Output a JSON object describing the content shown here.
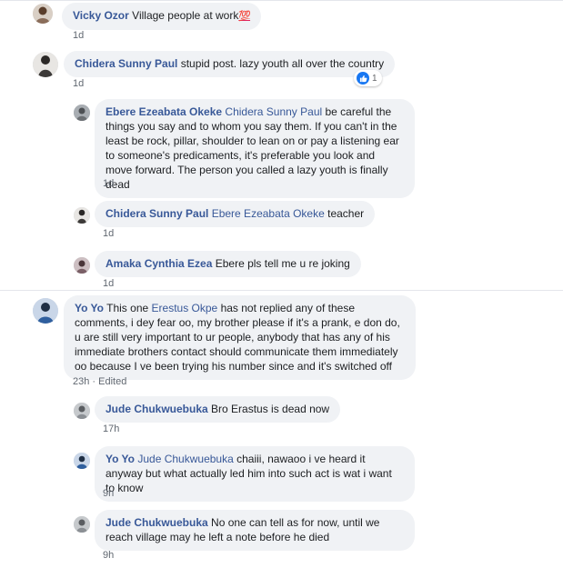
{
  "comments": [
    {
      "author": "Vicky Ozor",
      "text": "Village people at work",
      "emoji": "💯",
      "time": "1d",
      "avatar_color": "#8a6d5a"
    },
    {
      "author": "Chidera Sunny Paul",
      "text": "stupid post. lazy youth all over the country",
      "time": "1d",
      "reaction_count": "1",
      "avatar_color": "#3c3a38"
    },
    {
      "author": "Ebere Ezeabata Okeke",
      "mention": "Chidera Sunny Paul",
      "text": "be careful the things you say and to whom you say them. If you can't in the least be rock, pillar, shoulder to lean on or pay a listening ear to someone's predicaments, it's preferable you look and move forward. The person you called a lazy youth is finally dead",
      "time": "1d",
      "avatar_color": "#6b6f73"
    },
    {
      "author": "Chidera Sunny Paul",
      "mention": "Ebere Ezeabata Okeke",
      "text": "teacher",
      "time": "1d",
      "avatar_color": "#3c3a38"
    },
    {
      "author": "Amaka Cynthia Ezea",
      "text": "Ebere pls tell me u re joking",
      "time": "1d",
      "avatar_color": "#7a5f66"
    },
    {
      "author": "Yo Yo",
      "text_before": "This one",
      "mention": "Erestus Okpe",
      "text": "has not replied any of these comments, i dey fear oo, my brother please if it's a prank, e don do, u are still very important to ur people, anybody that has any of his immediate brothers contact should communicate them immediately oo because I ve been trying his number since and it's switched off",
      "time": "23h",
      "edited": "Edited",
      "avatar_color": "#2f5f9e"
    },
    {
      "author": "Jude Chukwuebuka",
      "text": "Bro Erastus is dead now",
      "time": "17h",
      "avatar_color": "#8b8f94"
    },
    {
      "author": "Yo Yo",
      "mention": "Jude Chukwuebuka",
      "text": "chaiii, nawaoo i ve heard it anyway but what actually led him into such act is wat i want to know",
      "time": "9h",
      "avatar_color": "#2f5f9e"
    },
    {
      "author": "Jude Chukwuebuka",
      "text": "No one can tell as for now, until we reach village may he left a note before he died",
      "time": "9h",
      "avatar_color": "#8b8f94"
    }
  ]
}
